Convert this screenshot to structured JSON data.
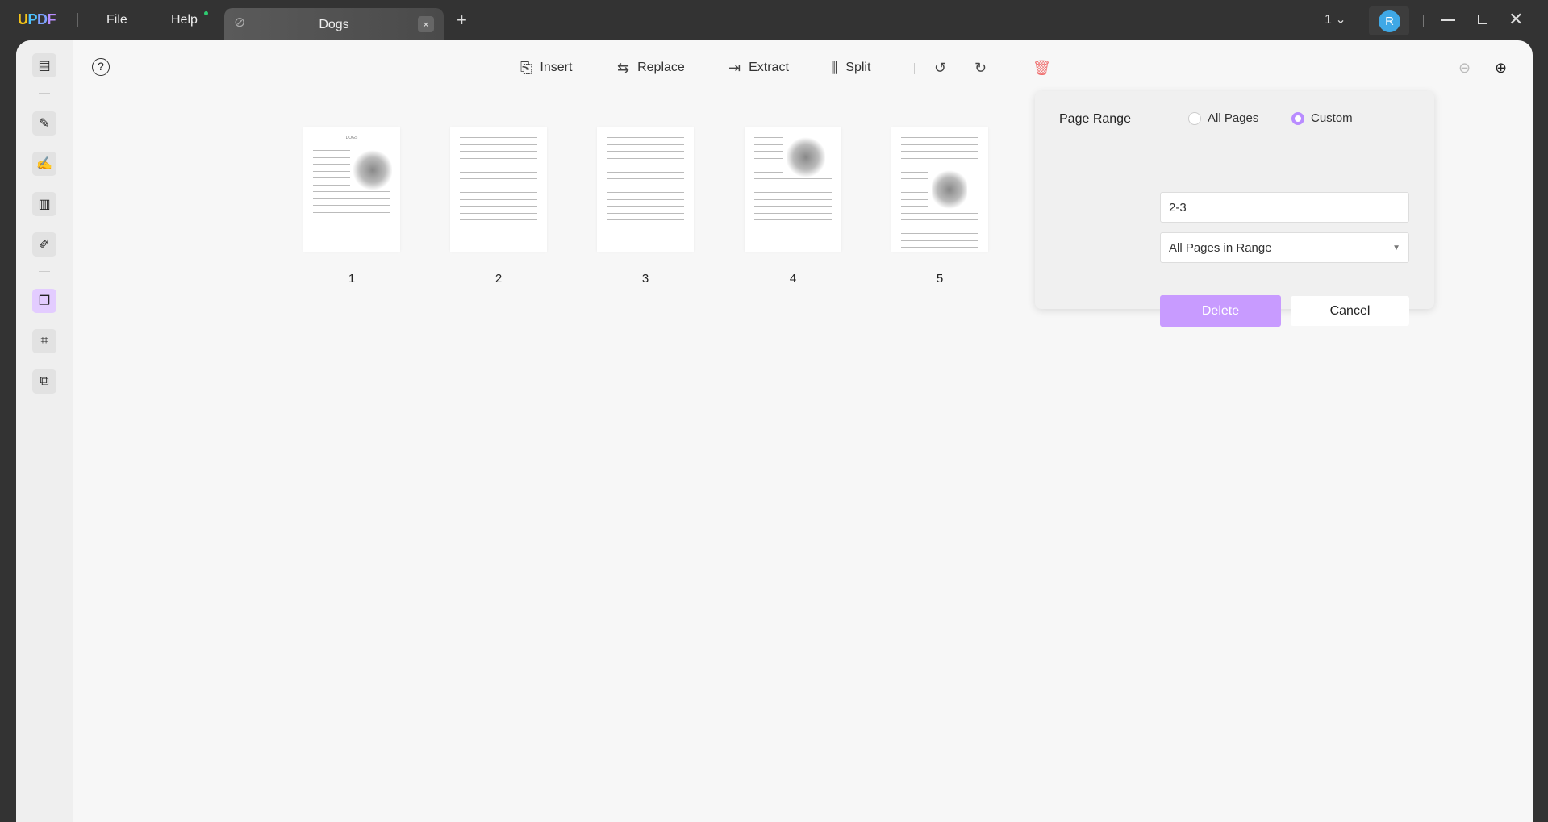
{
  "titlebar": {
    "logo": "UPDF",
    "menu": [
      "File",
      "Help"
    ],
    "tab_title": "Dogs",
    "tab_close": "×",
    "new_tab": "+",
    "page_indicator": "1",
    "avatar_letter": "R",
    "help_dot_color": "#2ecc71"
  },
  "sidebar": {
    "items": [
      "reader",
      "comment",
      "edit",
      "organize-columns",
      "fill-sign",
      "organize-pages",
      "crop",
      "watermark"
    ],
    "active": "organize-pages",
    "accent": "#b98cff"
  },
  "toolbar": {
    "insert": "Insert",
    "replace": "Replace",
    "extract": "Extract",
    "split": "Split"
  },
  "pages": [
    {
      "number": "1",
      "has_image": true,
      "title": "DOGS"
    },
    {
      "number": "2",
      "has_image": false
    },
    {
      "number": "3",
      "has_image": false
    },
    {
      "number": "4",
      "has_image": true
    },
    {
      "number": "5",
      "has_image": true
    }
  ],
  "panel": {
    "label": "Page Range",
    "option_all": "All Pages",
    "option_custom": "Custom",
    "selected": "Custom",
    "range_value": "2-3",
    "subset_select": "All Pages in Range",
    "delete": "Delete",
    "cancel": "Cancel",
    "delete_color": "#c89bff"
  }
}
